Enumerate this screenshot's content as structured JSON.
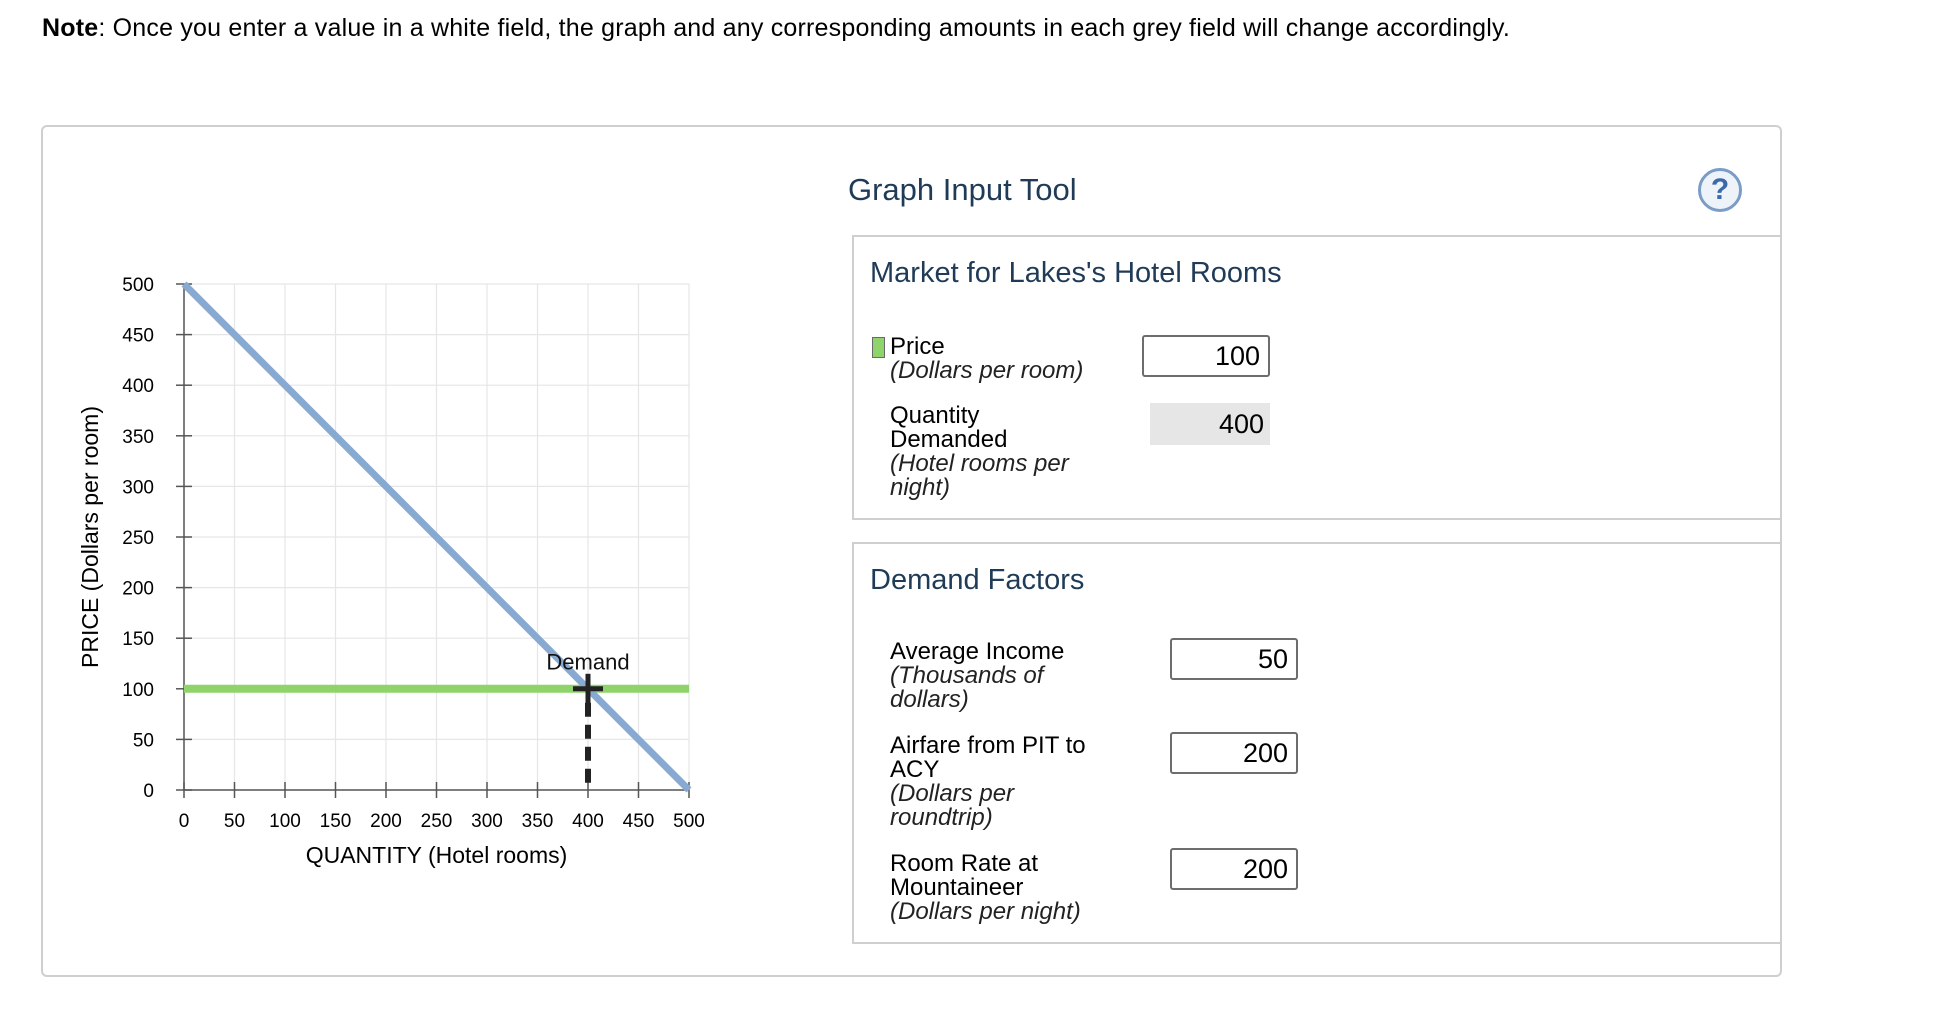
{
  "note": {
    "label": "Note",
    "text": ": Once you enter a value in a white field, the graph and any corresponding amounts in each grey field will change accordingly."
  },
  "graph_tool": {
    "title": "Graph Input Tool",
    "help_label": "?"
  },
  "market": {
    "title": "Market for Lakes's Hotel Rooms",
    "price": {
      "label": "Price",
      "unit": "(Dollars per room)",
      "value": "100",
      "swatch_color": "#8ed46a"
    },
    "quantity": {
      "label_line1": "Quantity",
      "label_line2": "Demanded",
      "unit_line1": "(Hotel rooms per",
      "unit_line2": "night)",
      "value": "400"
    }
  },
  "demand_factors": {
    "title": "Demand Factors",
    "income": {
      "label": "Average Income",
      "unit_line1": "(Thousands of",
      "unit_line2": "dollars)",
      "value": "50"
    },
    "airfare": {
      "label_line1": "Airfare from PIT to",
      "label_line2": "ACY",
      "unit_line1": "(Dollars per",
      "unit_line2": "roundtrip)",
      "value": "200"
    },
    "room_rate": {
      "label_line1": "Room Rate at",
      "label_line2": "Mountaineer",
      "unit": "(Dollars per night)",
      "value": "200"
    }
  },
  "chart_data": {
    "type": "line",
    "xlabel": "QUANTITY (Hotel rooms)",
    "ylabel": "PRICE (Dollars per room)",
    "xlim": [
      0,
      500
    ],
    "ylim": [
      0,
      500
    ],
    "x_ticks": [
      0,
      50,
      100,
      150,
      200,
      250,
      300,
      350,
      400,
      450,
      500
    ],
    "y_ticks": [
      0,
      50,
      100,
      150,
      200,
      250,
      300,
      350,
      400,
      450,
      500
    ],
    "grid": true,
    "series": [
      {
        "name": "Demand",
        "points": [
          [
            0,
            500
          ],
          [
            500,
            0
          ]
        ],
        "color": "#88a9d2"
      }
    ],
    "price_line": {
      "y": 100,
      "color": "#8ed46a"
    },
    "point": {
      "x": 400,
      "y": 100
    },
    "annotation": "Demand"
  }
}
